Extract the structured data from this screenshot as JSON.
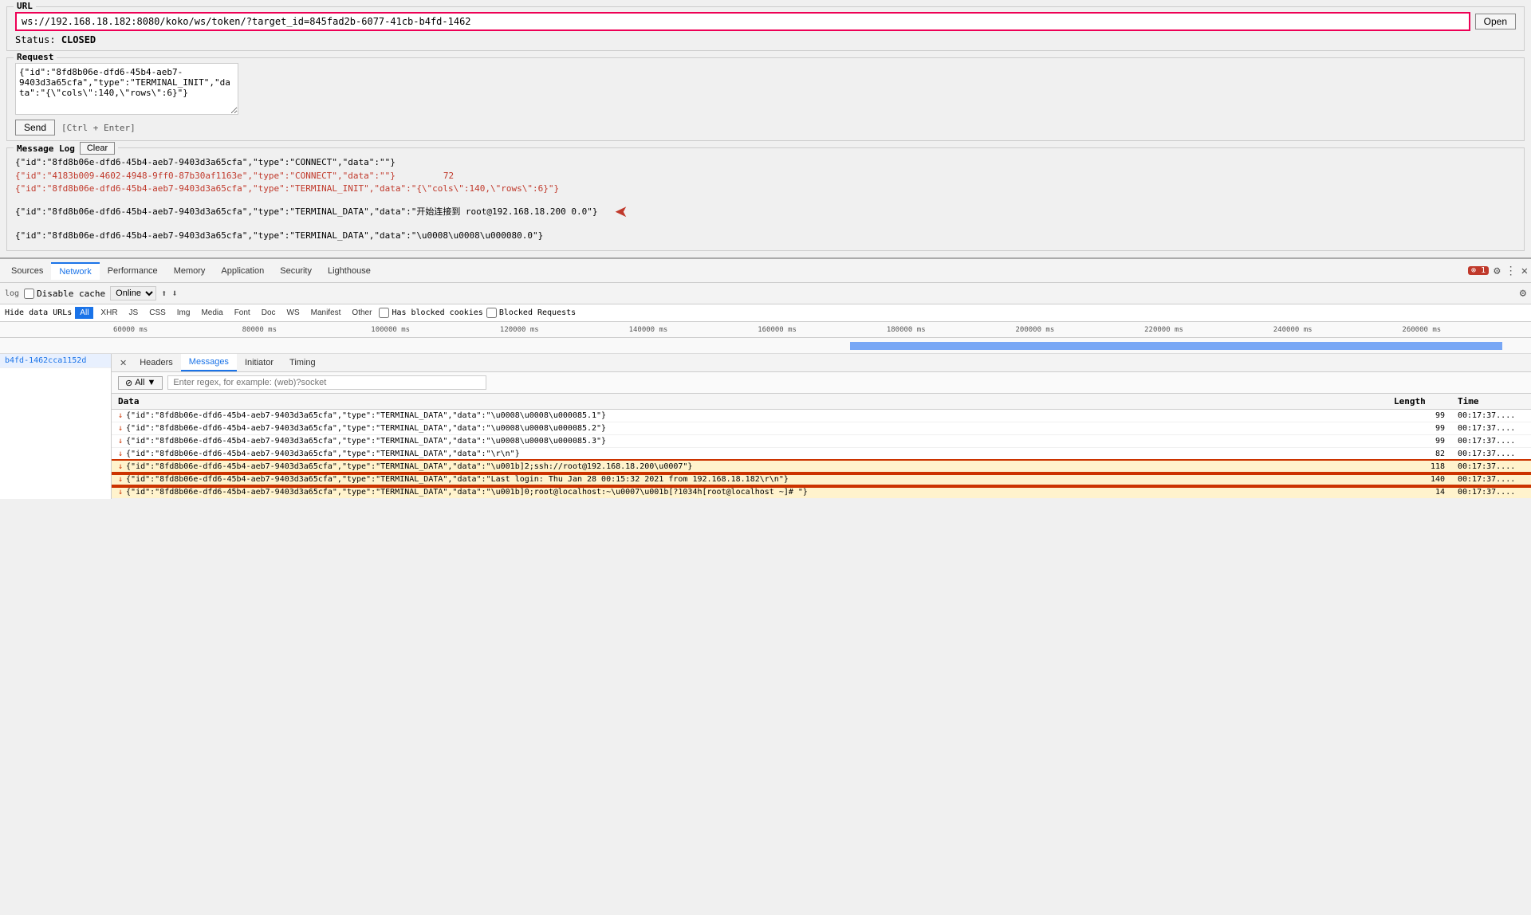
{
  "url_section": {
    "legend": "URL",
    "url_value": "ws://192.168.18.182:8080/koko/ws/token/?target_id=845fad2b-6077-41cb-b4fd-1462",
    "open_btn": "Open",
    "status_label": "Status:",
    "status_value": "CLOSED"
  },
  "request_section": {
    "legend": "Request",
    "textarea_value": "{\"id\":\"8fd8b06e-dfd6-45b4-aeb7-9403d3a65cfa\",\"type\":\"TERMINAL_INIT\",\"data\":\"{\\\"cols\\\":140,\\\"rows\\\":6}\"}",
    "send_btn": "Send",
    "ctrl_hint": "[Ctrl + Enter]"
  },
  "message_log": {
    "legend": "Message Log",
    "clear_btn": "Clear",
    "lines": [
      {
        "text": "{\"id\":\"8fd8b06e-dfd6-45b4-aeb7-9403d3a65cfa\",\"type\":\"CONNECT\",\"data\":\"\"}",
        "style": "black"
      },
      {
        "text": "{\"id\":\"4183b009-4602-4948-9ff0-87b30af1163e\",\"type\":\"CONNECT\",\"data\":\"\"}",
        "style": "red",
        "suffix": "72"
      },
      {
        "text": "{\"id\":\"8fd8b06e-dfd6-45b4-aeb7-9403d3a65cfa\",\"type\":\"TERMINAL_INIT\",\"data\":\"{\\\"cols\\\":140,\\\"rows\\\":6}\"}",
        "style": "red"
      },
      {
        "text": "{\"id\":\"8fd8b06e-dfd6-45b4-aeb7-9403d3a65cfa\",\"type\":\"TERMINAL_DATA\",\"data\":\"开始连接到 root@192.168.18.200  0.0\"}",
        "style": "black",
        "has_arrow": true
      },
      {
        "text": "{\"id\":\"8fd8b06e-dfd6-45b4-aeb7-9403d3a65cfa\",\"type\":\"TERMINAL_DATA\",\"data\":\"\\u0008\\u0008\\u000080.0\"}",
        "style": "black"
      }
    ]
  },
  "devtools": {
    "tabs": [
      {
        "label": "Sources",
        "active": false
      },
      {
        "label": "Network",
        "active": true
      },
      {
        "label": "Performance",
        "active": false
      },
      {
        "label": "Memory",
        "active": false
      },
      {
        "label": "Application",
        "active": false
      },
      {
        "label": "Security",
        "active": false
      },
      {
        "label": "Lighthouse",
        "active": false
      }
    ],
    "error_count": "1",
    "network_toolbar": {
      "disable_cache": "Disable cache",
      "online_label": "Online",
      "settings_label": "⚙"
    },
    "filter_bar": {
      "hide_data_urls": "Hide data URLs",
      "all_btn": "All",
      "types": [
        "XHR",
        "JS",
        "CSS",
        "Img",
        "Media",
        "Font",
        "Doc",
        "WS",
        "Manifest",
        "Other"
      ],
      "has_blocked_cookies": "Has blocked cookies",
      "blocked_requests": "Blocked Requests"
    },
    "timeline": {
      "labels": [
        "60000 ms",
        "80000 ms",
        "100000 ms",
        "120000 ms",
        "140000 ms",
        "160000 ms",
        "180000 ms",
        "200000 ms",
        "220000 ms",
        "240000 ms",
        "260000 ms"
      ]
    },
    "request_item": "b4fd-1462cca1152d",
    "detail_tabs": [
      {
        "label": "×",
        "type": "close"
      },
      {
        "label": "Headers",
        "active": false
      },
      {
        "label": "Messages",
        "active": true
      },
      {
        "label": "Initiator",
        "active": false
      },
      {
        "label": "Timing",
        "active": false
      }
    ],
    "messages_filter": {
      "all_label": "All",
      "dropdown": "▼",
      "placeholder": "Enter regex, for example: (web)?socket"
    },
    "messages_table": {
      "headers": [
        "Data",
        "Length",
        "Time"
      ],
      "rows": [
        {
          "data": "{\"id\":\"8fd8b06e-dfd6-45b4-aeb7-9403d3a65cfa\",\"type\":\"TERMINAL_DATA\",\"data\":\"\\u0008\\u0008\\u000085.1\"}",
          "length": "99",
          "time": "00:17:37....",
          "highlighted": false,
          "direction": "down"
        },
        {
          "data": "{\"id\":\"8fd8b06e-dfd6-45b4-aeb7-9403d3a65cfa\",\"type\":\"TERMINAL_DATA\",\"data\":\"\\u0008\\u0008\\u000085.2\"}",
          "length": "99",
          "time": "00:17:37....",
          "highlighted": false,
          "direction": "down"
        },
        {
          "data": "{\"id\":\"8fd8b06e-dfd6-45b4-aeb7-9403d3a65cfa\",\"type\":\"TERMINAL_DATA\",\"data\":\"\\u0008\\u0008\\u000085.3\"}",
          "length": "99",
          "time": "00:17:37....",
          "highlighted": false,
          "direction": "down"
        },
        {
          "data": "{\"id\":\"8fd8b06e-dfd6-45b4-aeb7-9403d3a65cfa\",\"type\":\"TERMINAL_DATA\",\"data\":\"\\r\\n\"}",
          "length": "82",
          "time": "00:17:37....",
          "highlighted": false,
          "direction": "down"
        },
        {
          "data": "{\"id\":\"8fd8b06e-dfd6-45b4-aeb7-9403d3a65cfa\",\"type\":\"TERMINAL_DATA\",\"data\":\"\\u001b]2;ssh://root@192.168.18.200\\u0007\"}",
          "length": "118",
          "time": "00:17:37....",
          "highlighted": true,
          "direction": "down"
        },
        {
          "data": "{\"id\":\"8fd8b06e-dfd6-45b4-aeb7-9403d3a65cfa\",\"type\":\"TERMINAL_DATA\",\"data\":\"Last login: Thu Jan 28 00:15:32 2021 from 192.168.18.182\\r\\n\"}",
          "length": "140",
          "time": "00:17:37....",
          "highlighted": true,
          "direction": "down"
        },
        {
          "data": "{\"id\":\"8fd8b06e-dfd6-45b4-aeb7-9403d3a65cfa\",\"type\":\"TERMINAL_DATA\",\"data\":\"\\u001b]0;root@localhost:~\\u0007\\u001b[?1034h[root@localhost ~]# \"}",
          "length": "14",
          "time": "00:17:37....",
          "highlighted": true,
          "direction": "down"
        }
      ]
    }
  }
}
